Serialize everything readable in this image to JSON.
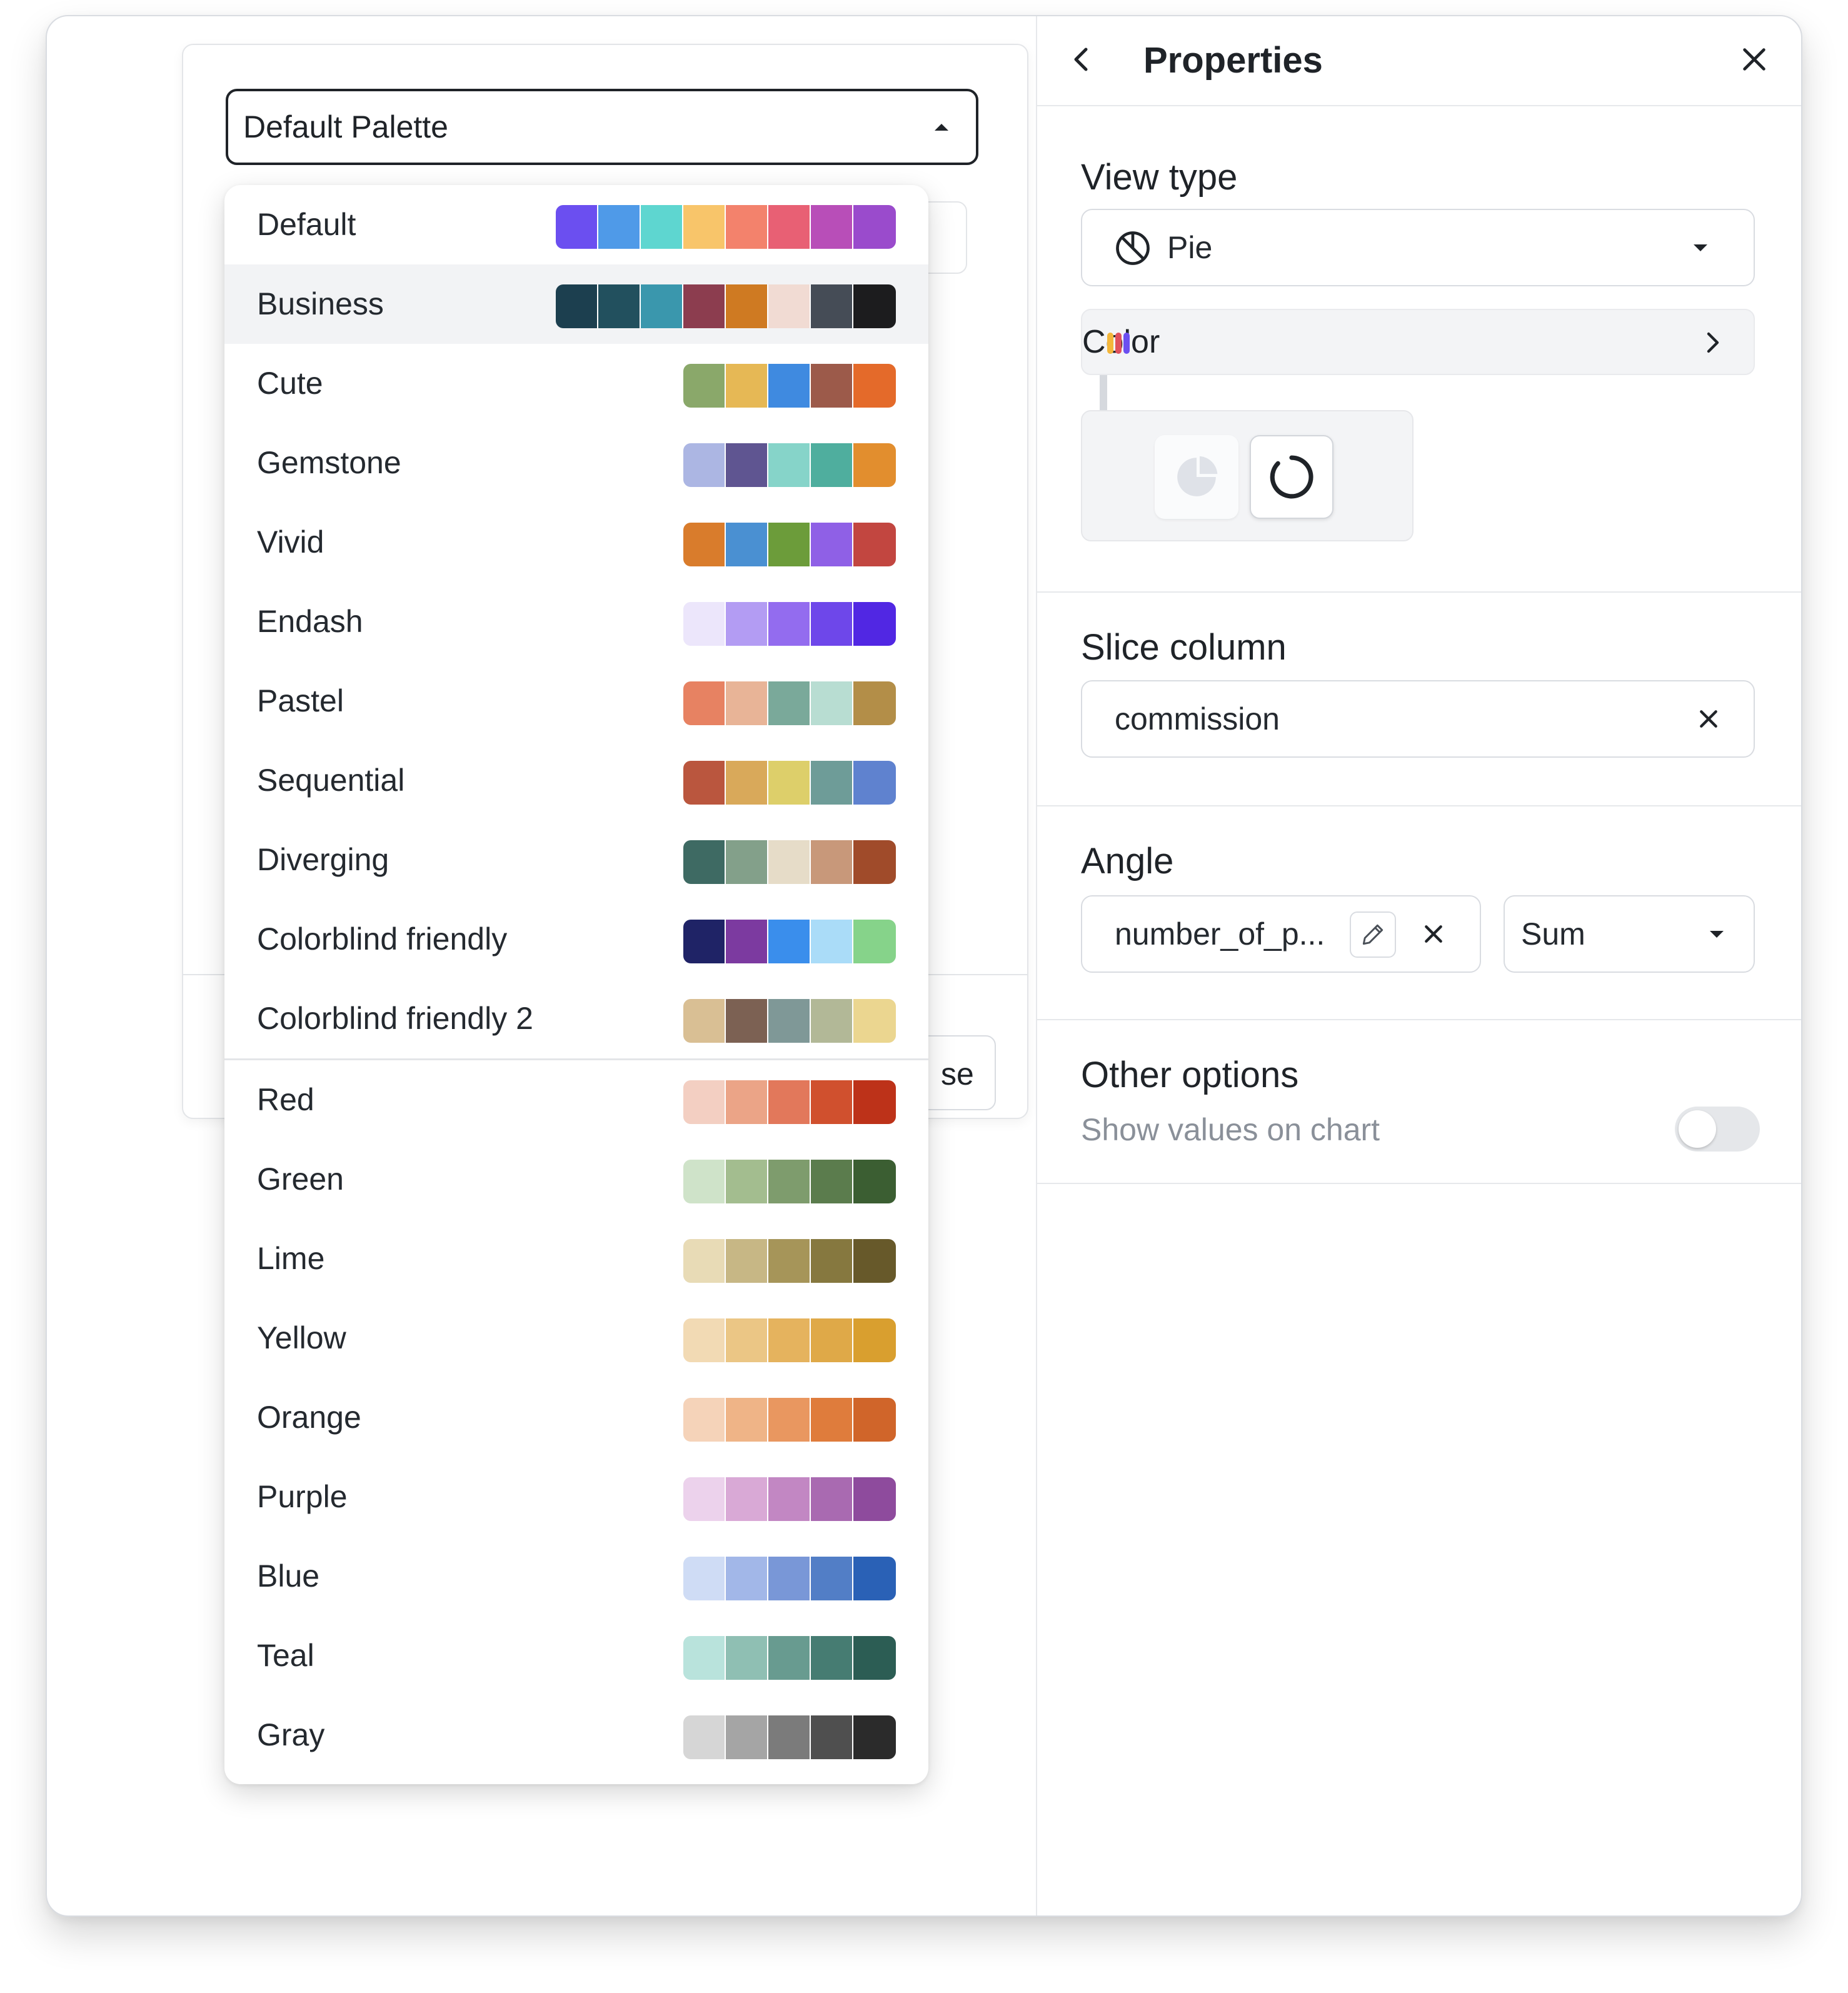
{
  "palette_select": {
    "value": "Default Palette"
  },
  "palettes_named": [
    {
      "name": "Default",
      "colors": [
        "#6b4ff0",
        "#4f9ae8",
        "#5ed6d0",
        "#f8c56a",
        "#f3826c",
        "#e86074",
        "#b84eb8",
        "#9a4bcc"
      ]
    },
    {
      "name": "Business",
      "colors": [
        "#1c3f4f",
        "#22505e",
        "#3a97ad",
        "#8c3d4f",
        "#cf7a22",
        "#f1dbd3",
        "#454c56",
        "#1c1c1e"
      ]
    },
    {
      "name": "Cute",
      "colors": [
        "#8aa86a",
        "#e6b855",
        "#3f8ae0",
        "#9c5a4a",
        "#e46a2a"
      ]
    },
    {
      "name": "Gemstone",
      "colors": [
        "#acb6e3",
        "#5f5591",
        "#86d4c9",
        "#4fae9e",
        "#e28e2e"
      ]
    },
    {
      "name": "Vivid",
      "colors": [
        "#d97c2c",
        "#4a90d2",
        "#6c9c3a",
        "#8f60e6",
        "#c24640"
      ]
    },
    {
      "name": "Endash",
      "colors": [
        "#ece6fb",
        "#b39cf3",
        "#936cef",
        "#6e47ea",
        "#5127e3"
      ]
    },
    {
      "name": "Pastel",
      "colors": [
        "#e78262",
        "#e8b497",
        "#7aa99a",
        "#b8ddd2",
        "#b38e48"
      ]
    },
    {
      "name": "Sequential",
      "colors": [
        "#ba563e",
        "#d9a95a",
        "#ddcf6a",
        "#6e9c98",
        "#5f82cf"
      ]
    },
    {
      "name": "Diverging",
      "colors": [
        "#3e6a63",
        "#83a08a",
        "#e6dcc8",
        "#c8987a",
        "#a04b2a"
      ]
    },
    {
      "name": "Colorblind friendly",
      "colors": [
        "#1f2366",
        "#7c3aa0",
        "#3a8eec",
        "#aadcf8",
        "#86d38a"
      ]
    },
    {
      "name": "Colorblind friendly 2",
      "colors": [
        "#d9bf94",
        "#7c6153",
        "#7f9897",
        "#b2b897",
        "#ebd690"
      ]
    }
  ],
  "palettes_color": [
    {
      "name": "Red",
      "colors": [
        "#f3cfc2",
        "#eba487",
        "#e2785b",
        "#d0502e",
        "#bd3219"
      ]
    },
    {
      "name": "Green",
      "colors": [
        "#cfe3c9",
        "#a3bd8f",
        "#7e9c6d",
        "#5b7c4d",
        "#3b5e32"
      ]
    },
    {
      "name": "Lime",
      "colors": [
        "#e8dbb6",
        "#c7b785",
        "#a69559",
        "#86783f",
        "#67592a"
      ]
    },
    {
      "name": "Yellow",
      "colors": [
        "#f2dab4",
        "#ebc685",
        "#e5b35e",
        "#dfa948",
        "#d99f2f"
      ]
    },
    {
      "name": "Orange",
      "colors": [
        "#f5d3b9",
        "#efb487",
        "#e99760",
        "#df7c3c",
        "#d0652a"
      ]
    },
    {
      "name": "Purple",
      "colors": [
        "#ecd2ec",
        "#d9a9d6",
        "#c287c3",
        "#a96ab1",
        "#8e4b9d"
      ]
    },
    {
      "name": "Blue",
      "colors": [
        "#cfdcf5",
        "#a2b7e8",
        "#7997d7",
        "#527ec6",
        "#2a61b6"
      ]
    },
    {
      "name": "Teal",
      "colors": [
        "#b9e3dc",
        "#8fbfb3",
        "#689b90",
        "#467c72",
        "#2c5d54"
      ]
    },
    {
      "name": "Gray",
      "colors": [
        "#d6d6d6",
        "#a5a5a5",
        "#7b7b7b",
        "#4f4f4f",
        "#2b2b2b"
      ]
    }
  ],
  "panel": {
    "title": "Properties",
    "view_type": {
      "label": "View type",
      "value": "Pie",
      "color_label": "Color"
    },
    "slice_column": {
      "label": "Slice column",
      "value": "commission"
    },
    "angle": {
      "label": "Angle",
      "value": "number_of_p...",
      "aggregate": "Sum"
    },
    "other_options": {
      "label": "Other options",
      "show_values_label": "Show values on chart",
      "show_values": false
    }
  },
  "background_dialog": {
    "button_label_partial": "se"
  }
}
